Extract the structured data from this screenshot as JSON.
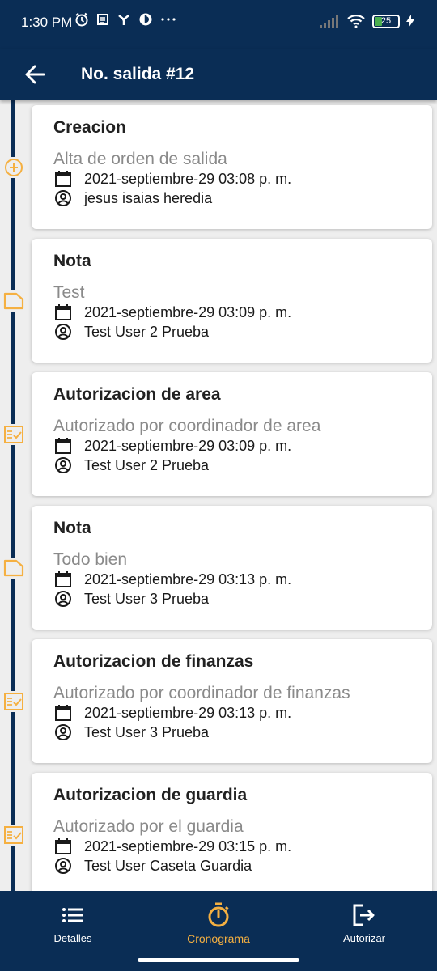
{
  "status_bar": {
    "time": "1:30 PM",
    "battery": "25"
  },
  "app_bar": {
    "title": "No. salida #12",
    "back_icon": "arrow-left-icon"
  },
  "timeline": [
    {
      "title": "Creacion",
      "description": "Alta de orden de salida",
      "date": "2021-septiembre-29 03:08 p. m.",
      "user": "jesus isaias heredia",
      "marker_icon": "plus-circle-icon"
    },
    {
      "title": "Nota",
      "description": "Test",
      "date": "2021-septiembre-29 03:09 p. m.",
      "user": "Test User 2 Prueba",
      "marker_icon": "note-icon"
    },
    {
      "title": "Autorizacion de area",
      "description": "Autorizado por coordinador de area",
      "date": "2021-septiembre-29 03:09 p. m.",
      "user": "Test User 2 Prueba",
      "marker_icon": "checklist-icon"
    },
    {
      "title": "Nota",
      "description": "Todo bien",
      "date": "2021-septiembre-29 03:13 p. m.",
      "user": "Test User 3 Prueba",
      "marker_icon": "note-icon"
    },
    {
      "title": "Autorizacion de finanzas",
      "description": "Autorizado por coordinador de finanzas",
      "date": "2021-septiembre-29 03:13 p. m.",
      "user": "Test User 3 Prueba",
      "marker_icon": "checklist-icon"
    },
    {
      "title": "Autorizacion de guardia",
      "description": "Autorizado por el guardia",
      "date": "2021-septiembre-29 03:15 p. m.",
      "user": "Test User Caseta Guardia",
      "marker_icon": "checklist-icon"
    }
  ],
  "bottom_nav": [
    {
      "label": "Detalles",
      "icon": "list-icon",
      "active": false
    },
    {
      "label": "Cronograma",
      "icon": "timer-icon",
      "active": true
    },
    {
      "label": "Autorizar",
      "icon": "logout-icon",
      "active": false
    }
  ],
  "colors": {
    "primary": "#0a2d55",
    "accent": "#f5b041",
    "background": "#eeeeee"
  }
}
